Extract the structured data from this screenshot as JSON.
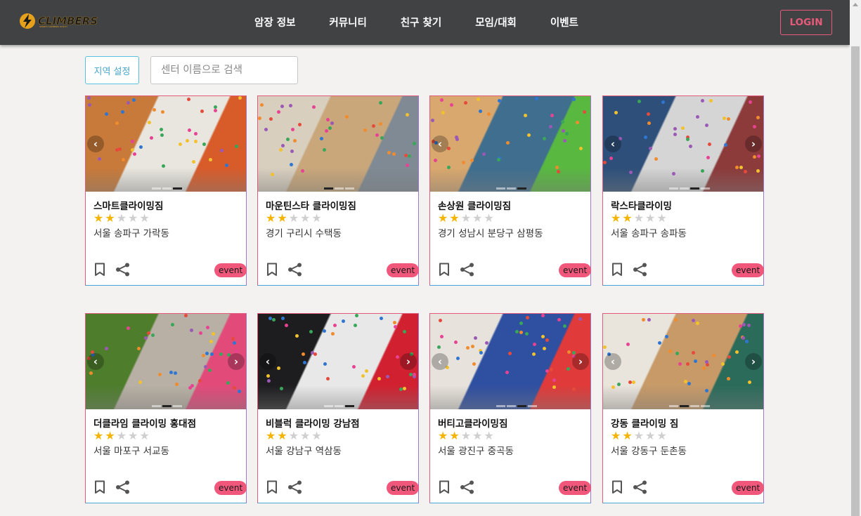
{
  "header": {
    "logo_text": "CLIMBERS",
    "logo_subtext": "SPORTS CLIMBERS UTILITY",
    "nav": [
      "암장 정보",
      "커뮤니티",
      "친구 찾기",
      "모임/대회",
      "이벤트"
    ],
    "login_label": "LOGIN"
  },
  "filters": {
    "region_label": "지역 설정",
    "search_placeholder": "센터 이름으로 검색"
  },
  "gyms": [
    {
      "name": "스마트클라이밍짐",
      "rating": 2,
      "max_rating": 5,
      "address": "서울 송파구 가락동",
      "badge": "event",
      "image_colors": [
        "#c87a3a",
        "#e9e6df",
        "#d85c2a"
      ],
      "slide_count": 3,
      "active_slide": 3
    },
    {
      "name": "마운틴스타 클라이밍짐",
      "rating": 2,
      "max_rating": 5,
      "address": "경기 구리시 수택동",
      "badge": "event",
      "image_colors": [
        "#d8cfbf",
        "#c9a77a",
        "#7f8a94"
      ],
      "slide_count": 3,
      "active_slide": 0
    },
    {
      "name": "손상원 클라이밍짐",
      "rating": 2,
      "max_rating": 5,
      "address": "경기 성남시 분당구 삼평동",
      "badge": "event",
      "image_colors": [
        "#d9a86e",
        "#3f6e8f",
        "#58b840"
      ],
      "slide_count": 3,
      "active_slide": 3
    },
    {
      "name": "락스타클라이밍",
      "rating": 2,
      "max_rating": 5,
      "address": "서울 송파구 송파동",
      "badge": "event",
      "image_colors": [
        "#2e4f7a",
        "#d5d5d5",
        "#8c3a3a"
      ],
      "slide_count": 4,
      "active_slide": 3
    },
    {
      "name": "더클라임 클라이밍 홍대점",
      "rating": 2,
      "max_rating": 5,
      "address": "서울 마포구 서교동",
      "badge": "event",
      "image_colors": [
        "#4e7d2c",
        "#b8b0a4",
        "#e24a7a"
      ],
      "slide_count": 3,
      "active_slide": 2
    },
    {
      "name": "비블럭 클라이밍 강남점",
      "rating": 2,
      "max_rating": 5,
      "address": "서울 강남구 역삼동",
      "badge": "event",
      "image_colors": [
        "#1d1d1f",
        "#e8e8e8",
        "#d12030"
      ],
      "slide_count": 3,
      "active_slide": 3
    },
    {
      "name": "버티고클라이밍짐",
      "rating": 2,
      "max_rating": 5,
      "address": "서울 광진구 중곡동",
      "badge": "event",
      "image_colors": [
        "#e7e3dc",
        "#2f4fa0",
        "#e03a3a"
      ],
      "slide_count": 4,
      "active_slide": 3
    },
    {
      "name": "강동 클라이밍 짐",
      "rating": 2,
      "max_rating": 5,
      "address": "서울 강동구 둔촌동",
      "badge": "event",
      "image_colors": [
        "#e9e4dc",
        "#c79a68",
        "#2b6b5a"
      ],
      "slide_count": 4,
      "active_slide": 2
    }
  ]
}
